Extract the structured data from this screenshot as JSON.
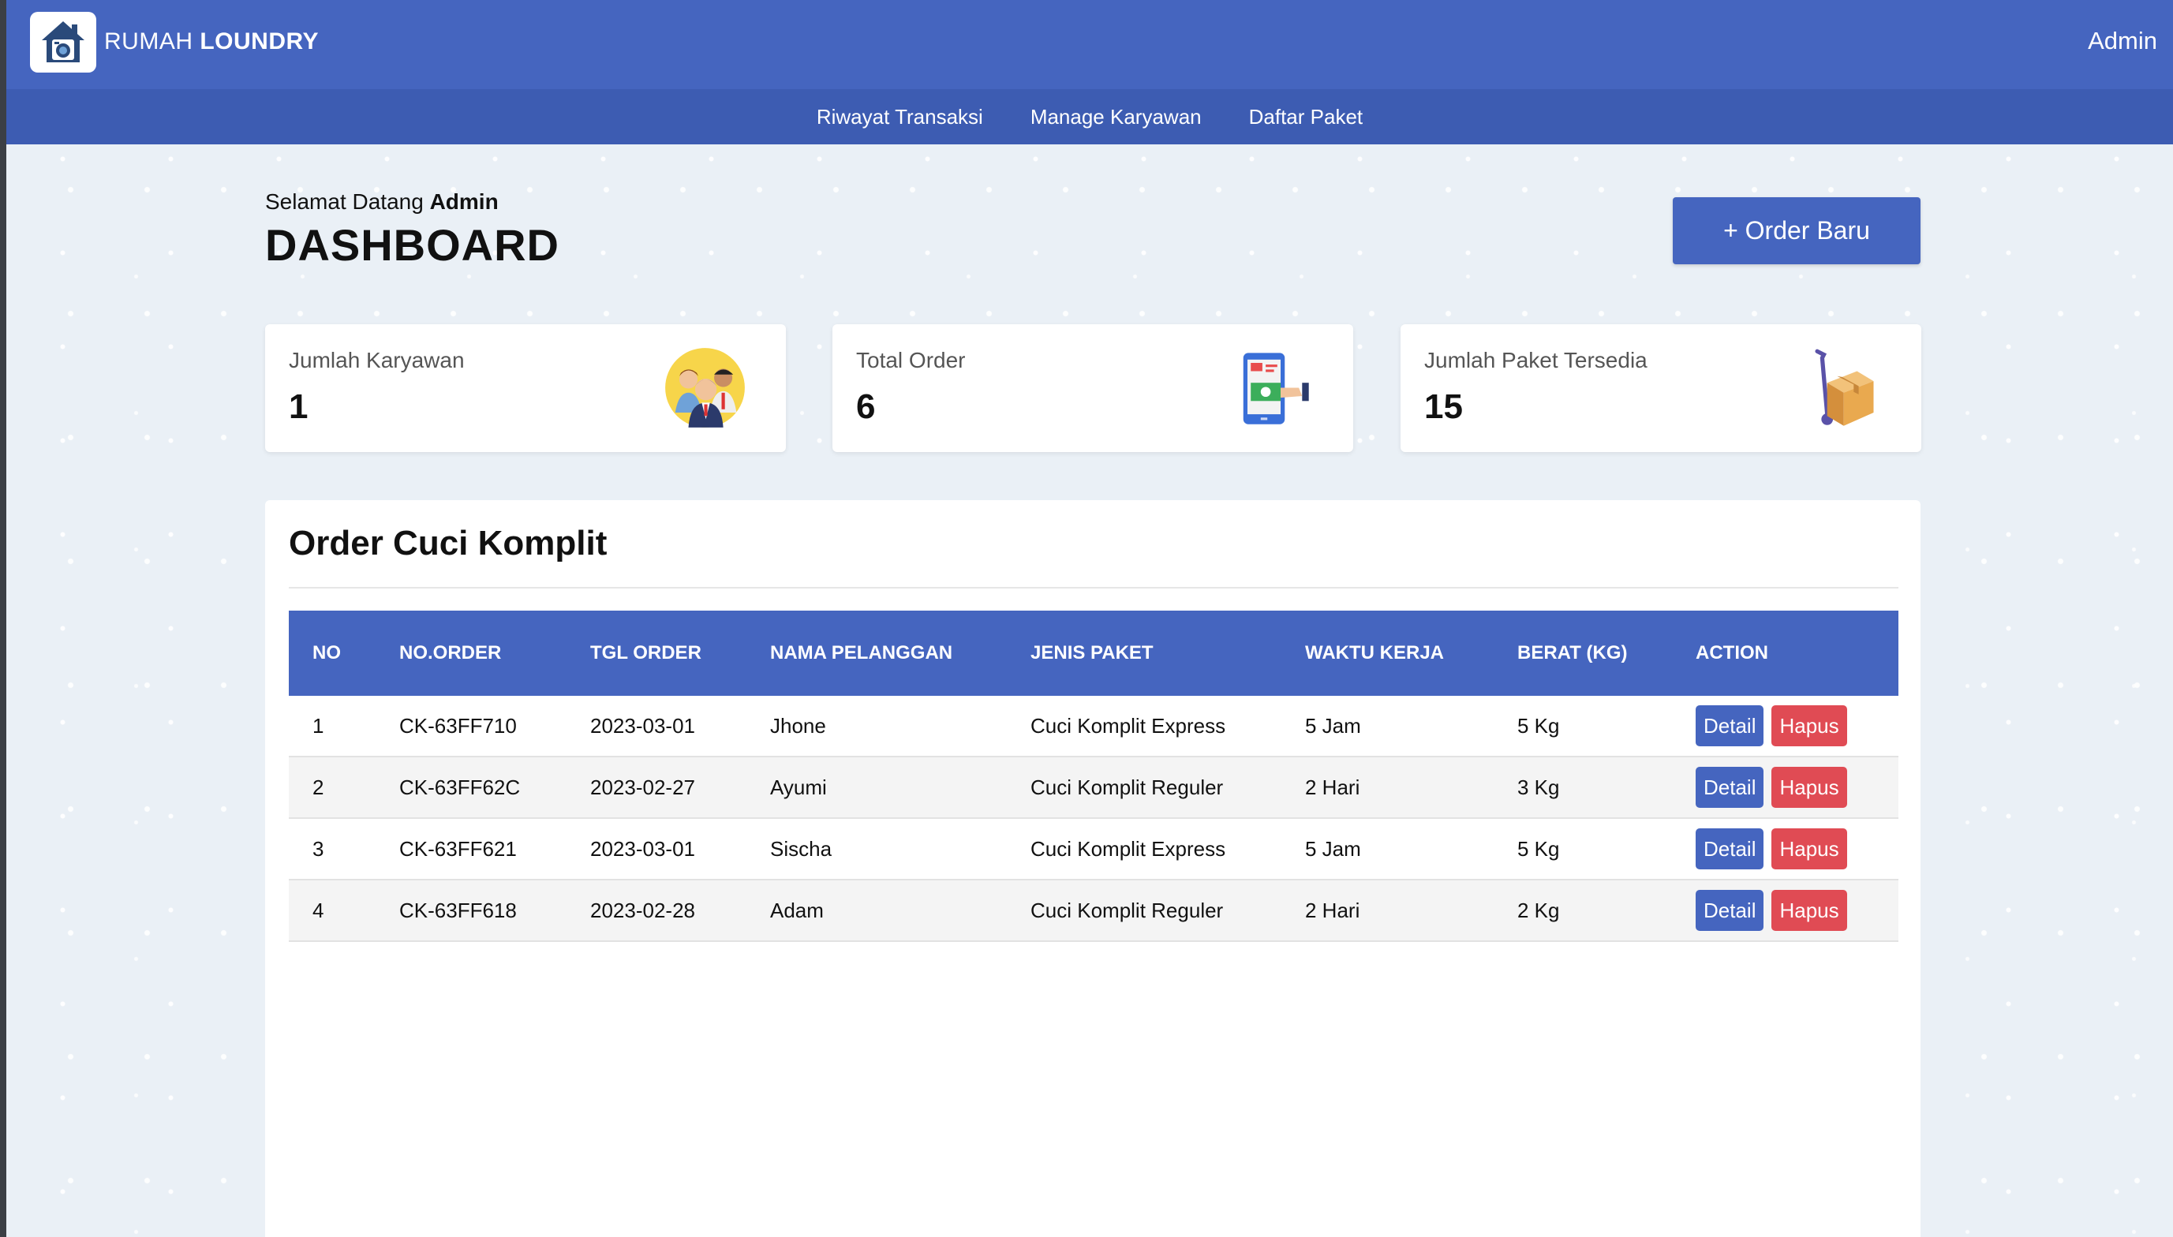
{
  "header": {
    "brand_light": "RUMAH ",
    "brand_bold": "LOUNDRY",
    "user": "Admin"
  },
  "nav": [
    "Riwayat Transaksi",
    "Manage Karyawan",
    "Daftar Paket"
  ],
  "page": {
    "welcome_prefix": "Selamat Datang ",
    "welcome_name": "Admin",
    "title": "DASHBOARD",
    "new_order_label": "+ Order Baru"
  },
  "cards": [
    {
      "label": "Jumlah Karyawan",
      "value": "1",
      "icon": "employees-icon"
    },
    {
      "label": "Total Order",
      "value": "6",
      "icon": "mobile-payment-icon"
    },
    {
      "label": "Jumlah Paket Tersedia",
      "value": "15",
      "icon": "package-trolley-icon"
    }
  ],
  "orders": {
    "title": "Order Cuci Komplit",
    "columns": [
      "NO",
      "NO.ORDER",
      "TGL ORDER",
      "NAMA PELANGGAN",
      "JENIS PAKET",
      "WAKTU KERJA",
      "BERAT (KG)",
      "ACTION"
    ],
    "rows": [
      [
        "1",
        "CK-63FF710",
        "2023-03-01",
        "Jhone",
        "Cuci Komplit Express",
        "5 Jam",
        "5 Kg"
      ],
      [
        "2",
        "CK-63FF62C",
        "2023-02-27",
        "Ayumi",
        "Cuci Komplit Reguler",
        "2 Hari",
        "3 Kg"
      ],
      [
        "3",
        "CK-63FF621",
        "2023-03-01",
        "Sischa",
        "Cuci Komplit Express",
        "5 Jam",
        "5 Kg"
      ],
      [
        "4",
        "CK-63FF618",
        "2023-02-28",
        "Adam",
        "Cuci Komplit Reguler",
        "2 Hari",
        "2 Kg"
      ]
    ],
    "detail_label": "Detail",
    "delete_label": "Hapus"
  },
  "colors": {
    "primary": "#4565bf",
    "nav": "#3d5cb2",
    "danger": "#e04b54"
  }
}
